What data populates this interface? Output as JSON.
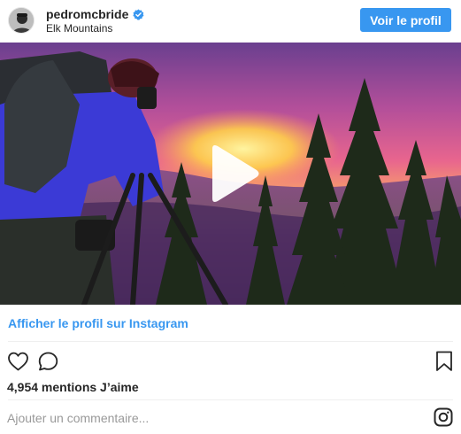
{
  "header": {
    "username": "pedromcbride",
    "location": "Elk Mountains",
    "profile_button": "Voir le profil",
    "verified_icon": "verified-badge-icon"
  },
  "media": {
    "type": "video",
    "play_icon": "play-icon"
  },
  "view_profile_link": "Afficher le profil sur Instagram",
  "actions": {
    "like_icon": "heart-icon",
    "comment_icon": "comment-icon",
    "save_icon": "bookmark-icon"
  },
  "likes_text": "4,954 mentions J’aime",
  "comment": {
    "placeholder": "Ajouter un commentaire...",
    "value": ""
  },
  "logo_icon": "instagram-icon",
  "colors": {
    "accent": "#3897f0",
    "text": "#262626",
    "muted": "#999999",
    "divider": "#efefef"
  }
}
